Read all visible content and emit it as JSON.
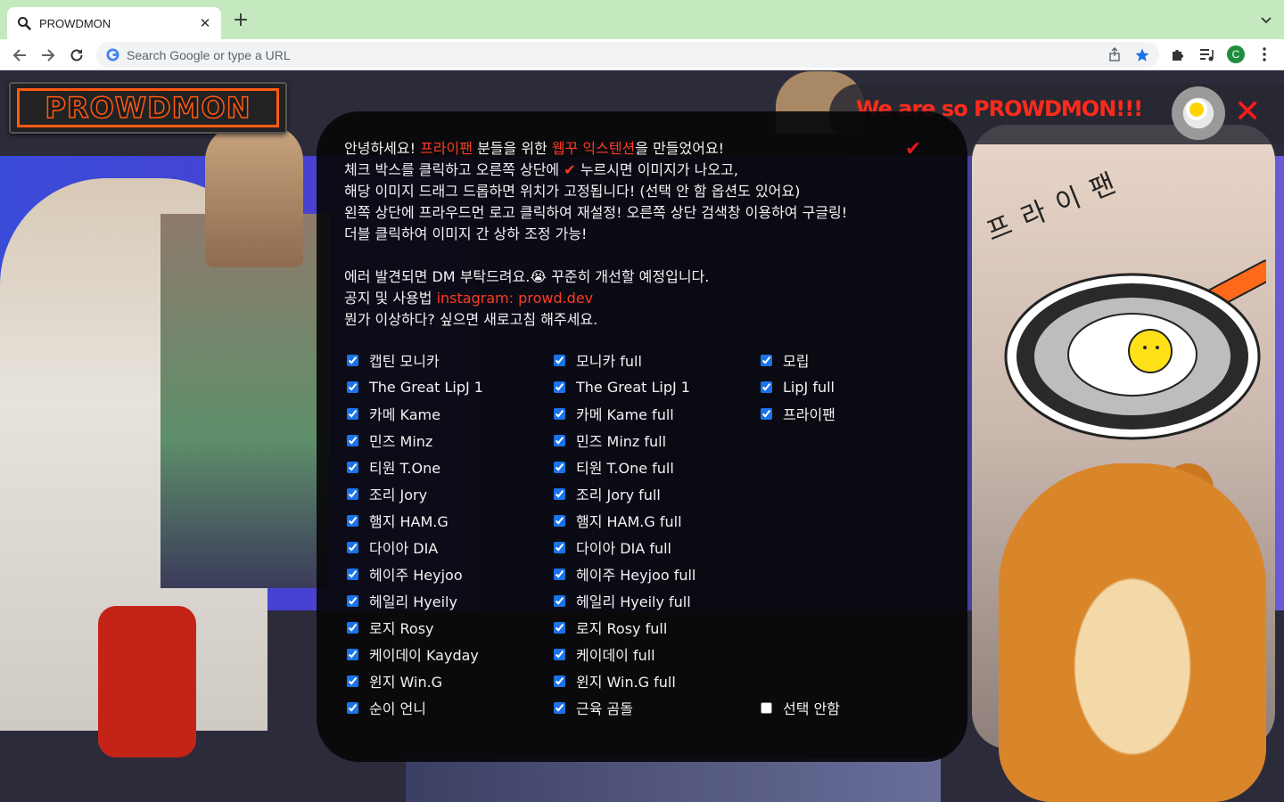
{
  "browser": {
    "tab_title": "PROWDMON",
    "new_tab_label": "+",
    "omnibox_placeholder": "Search Google or type a URL",
    "profile_initial": "C"
  },
  "page": {
    "logo_text": "PROWDMON",
    "banner_text": "We are so PROWDMON!!!",
    "close_symbol": "✕",
    "fryfan_text": "프라이팬",
    "intro": {
      "l1_a": "안녕하세요! ",
      "l1_hl1": "프라이팬",
      "l1_b": " 분들을 위한 ",
      "l1_hl2": "웹꾸 익스텐션",
      "l1_c": "을 만들었어요!",
      "l2_a": "체크 박스를 클릭하고 오른쪽 상단에 ",
      "l2_check": "✔",
      "l2_b": " 누르시면 이미지가 나오고,",
      "l3": "해당 이미지 드래그 드롭하면 위치가 고정됩니다! (선택 안 함 옵션도 있어요)",
      "l4": "왼쪽 상단에 프라우드먼 로고 클릭하여 재설정! 오른쪽 상단 검색창 이용하여 구글링!",
      "l5": "더블 클릭하여 이미지 간 상하 조정 가능!",
      "l6": "에러 발견되면 DM 부탁드려요.😭 꾸준히 개선할 예정입니다.",
      "l7_a": "공지 및 사용법 ",
      "l7_hl": "instagram: prowd.dev",
      "l8": "뭔가 이상하다? 싶으면 새로고침 해주세요."
    },
    "apply_check": "✔",
    "options_col1": [
      {
        "label": "캡틴 모니카",
        "checked": true
      },
      {
        "label": "The Great LipJ 1",
        "checked": true
      },
      {
        "label": "카메 Kame",
        "checked": true
      },
      {
        "label": "민즈 Minz",
        "checked": true
      },
      {
        "label": "티원 T.One",
        "checked": true
      },
      {
        "label": "조리 Jory",
        "checked": true
      },
      {
        "label": "햄지 HAM.G",
        "checked": true
      },
      {
        "label": "다이아 DIA",
        "checked": true
      },
      {
        "label": "헤이주 Heyjoo",
        "checked": true
      },
      {
        "label": "헤일리 Hyeily",
        "checked": true
      },
      {
        "label": "로지 Rosy",
        "checked": true
      },
      {
        "label": "케이데이 Kayday",
        "checked": true
      },
      {
        "label": "윈지 Win.G",
        "checked": true
      },
      {
        "label": "순이 언니",
        "checked": true
      }
    ],
    "options_col2": [
      {
        "label": "모니카 full",
        "checked": true
      },
      {
        "label": "The Great LipJ 1",
        "checked": true
      },
      {
        "label": "카메 Kame full",
        "checked": true
      },
      {
        "label": "민즈 Minz full",
        "checked": true
      },
      {
        "label": "티원 T.One full",
        "checked": true
      },
      {
        "label": "조리 Jory full",
        "checked": true
      },
      {
        "label": "햄지 HAM.G full",
        "checked": true
      },
      {
        "label": "다이아 DIA full",
        "checked": true
      },
      {
        "label": "헤이주 Heyjoo full",
        "checked": true
      },
      {
        "label": "헤일리 Hyeily full",
        "checked": true
      },
      {
        "label": "로지 Rosy full",
        "checked": true
      },
      {
        "label": "케이데이 full",
        "checked": true
      },
      {
        "label": "윈지 Win.G full",
        "checked": true
      },
      {
        "label": "근육 곰돌",
        "checked": true
      }
    ],
    "options_col3": [
      {
        "label": "모립",
        "checked": true
      },
      {
        "label": "LipJ full",
        "checked": true
      },
      {
        "label": "프라이팬",
        "checked": true
      },
      {
        "label": "선택 안함",
        "checked": false,
        "row": 13
      }
    ]
  },
  "colors": {
    "accent_red": "#ff3b22",
    "logo_orange": "#ff5a14",
    "tabbar": "#c4e9bf"
  }
}
